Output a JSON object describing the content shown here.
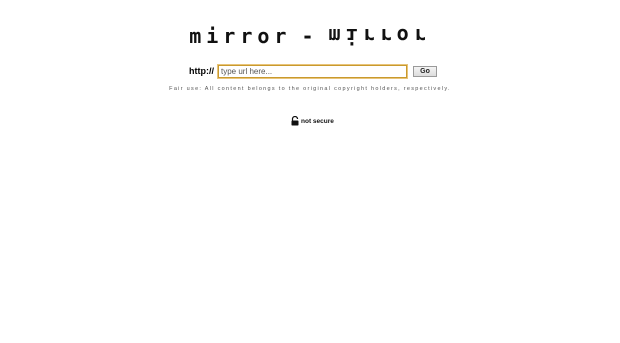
{
  "logo": {
    "left_text": "mirror",
    "separator": "-",
    "right_text": "mirror"
  },
  "form": {
    "prefix": "http://",
    "input_placeholder": "type url here...",
    "input_value": "",
    "go_label": "Go"
  },
  "disclaimer": "Fair use: All content belongs to the original copyright holders, respectively.",
  "security": {
    "icon": "unlocked-padlock-icon",
    "label": "not secure"
  },
  "colors": {
    "input_focus_border": "#c99a2e",
    "text": "#111111"
  }
}
